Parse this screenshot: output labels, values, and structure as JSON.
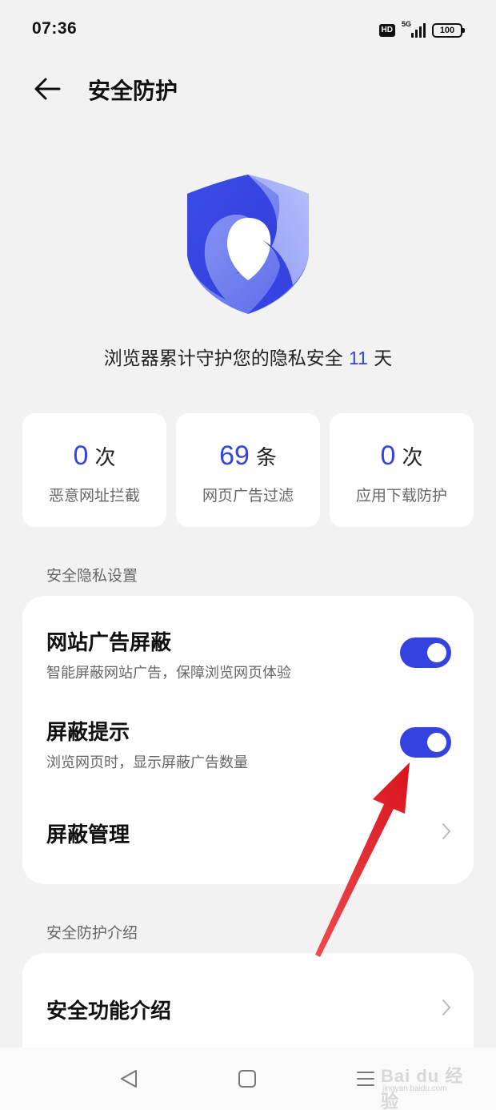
{
  "status_bar": {
    "time": "07:36",
    "hd": "HD",
    "network": "5G",
    "battery": "100"
  },
  "header": {
    "title": "安全防护"
  },
  "hero": {
    "text_before": "浏览器累计守护您的隐私安全 ",
    "days": "11",
    "text_after": " 天"
  },
  "stats": [
    {
      "value": "0",
      "unit": "次",
      "label": "恶意网址拦截"
    },
    {
      "value": "69",
      "unit": "条",
      "label": "网页广告过滤"
    },
    {
      "value": "0",
      "unit": "次",
      "label": "应用下载防护"
    }
  ],
  "privacy_section": {
    "title": "安全隐私设置",
    "ad_block": {
      "title": "网站广告屏蔽",
      "subtitle": "智能屏蔽网站广告，保障浏览网页体验",
      "enabled": true
    },
    "block_hint": {
      "title": "屏蔽提示",
      "subtitle": "浏览网页时，显示屏蔽广告数量",
      "enabled": true
    },
    "block_manage": {
      "title": "屏蔽管理"
    }
  },
  "intro_section": {
    "title": "安全防护介绍",
    "feature_intro": {
      "title": "安全功能介绍"
    }
  },
  "colors": {
    "accent": "#3443e0",
    "background": "#f2f2f2",
    "card": "#ffffff",
    "annotation_arrow": "#e8202a"
  },
  "watermark": {
    "main": "Bai du 经验",
    "sub": "jingyan.baidu.com"
  }
}
